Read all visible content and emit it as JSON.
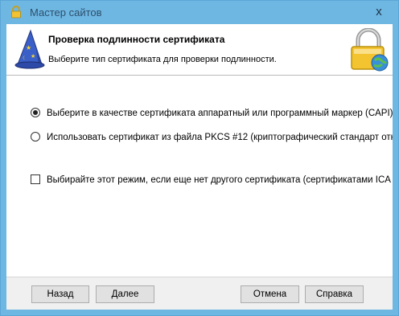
{
  "window": {
    "title": "Мастер сайтов",
    "close_label": "x"
  },
  "header": {
    "title": "Проверка подлинности сертификата",
    "subtitle": "Выберите тип сертификата для проверки подлинности."
  },
  "options": {
    "radio_capi": {
      "label": "Выберите в качестве сертификата аппаратный или программный маркер (CAPI)",
      "checked": true
    },
    "radio_pkcs": {
      "label": "Использовать сертификат из файла PKCS #12 (криптографический стандарт отн",
      "checked": false
    },
    "checkbox_ica": {
      "label": "Выбирайте этот режим, если еще нет другого сертификата (сертификатами ICA",
      "checked": false
    }
  },
  "buttons": {
    "back": "Назад",
    "next": "Далее",
    "cancel": "Отмена",
    "help": "Справка"
  },
  "colors": {
    "titlebar": "#6fb7e3",
    "dialog_bg": "#f0f0f0",
    "button_bg": "#e1e1e1"
  },
  "icons": {
    "title": "padlock-icon",
    "wizard": "wizard-hat-icon",
    "header": "padlock-globe-icon",
    "close": "close-icon"
  }
}
